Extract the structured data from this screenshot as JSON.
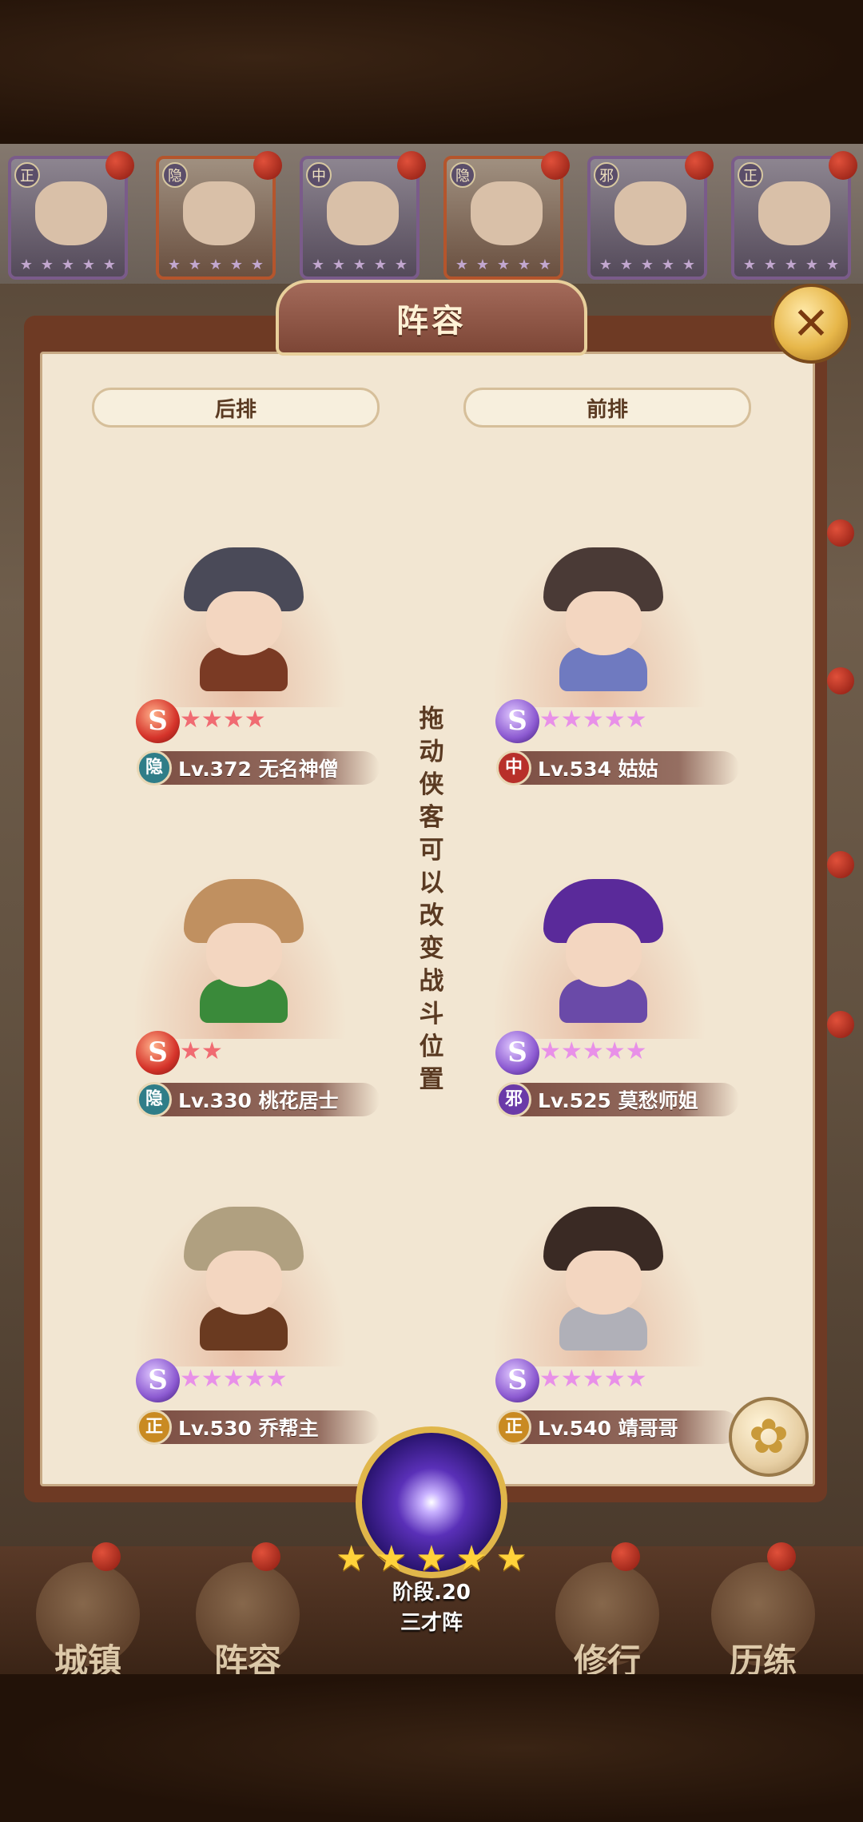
{
  "panel": {
    "title": "阵容",
    "back_row_label": "后排",
    "front_row_label": "前排",
    "hint": "拖动侠客可以改变战斗位置"
  },
  "top_strip": [
    {
      "tag": "正"
    },
    {
      "tag": "隐"
    },
    {
      "tag": "中"
    },
    {
      "tag": "隐"
    },
    {
      "tag": "邪"
    },
    {
      "tag": "正"
    }
  ],
  "heroes": [
    {
      "faction": "隐",
      "faction_color": "#2f7d88",
      "grade": "S",
      "stars": 4,
      "star_color": "#f06b72",
      "level_name": "Lv.372 无名神僧",
      "hair": "#4a4a58",
      "body": "#7a3a24"
    },
    {
      "faction": "中",
      "faction_color": "#b8302a",
      "grade": "S",
      "stars": 5,
      "star_color": "#e890e8",
      "level_name": "Lv.534 姑姑",
      "hair": "#4a3a36",
      "body": "#6f7ac0"
    },
    {
      "faction": "隐",
      "faction_color": "#2f7d88",
      "grade": "S",
      "stars": 2,
      "star_color": "#f06b72",
      "level_name": "Lv.330 桃花居士",
      "hair": "#c09060",
      "body": "#3a8a3a"
    },
    {
      "faction": "邪",
      "faction_color": "#6a3aa8",
      "grade": "S",
      "stars": 5,
      "star_color": "#e890e8",
      "level_name": "Lv.525 莫愁师姐",
      "hair": "#5a2a9a",
      "body": "#6a4aa8"
    },
    {
      "faction": "正",
      "faction_color": "#c98a22",
      "grade": "S",
      "stars": 5,
      "star_color": "#e890e8",
      "level_name": "Lv.530 乔帮主",
      "hair": "#b0a080",
      "body": "#6a3a20"
    },
    {
      "faction": "正",
      "faction_color": "#c98a22",
      "grade": "S",
      "stars": 5,
      "star_color": "#e890e8",
      "level_name": "Lv.540 靖哥哥",
      "hair": "#3a2a24",
      "body": "#b0b0b8"
    }
  ],
  "formation": {
    "stars": 5,
    "stage": "阶段.20",
    "name": "三才阵"
  },
  "bottom_nav": [
    {
      "label": "城镇"
    },
    {
      "label": "阵容"
    },
    {
      "label": "修行"
    },
    {
      "label": "历练"
    }
  ],
  "colors": {
    "panel_bg": "#f2e6d2",
    "frame": "#6e3a24",
    "accent_gold": "#e0b64a"
  }
}
